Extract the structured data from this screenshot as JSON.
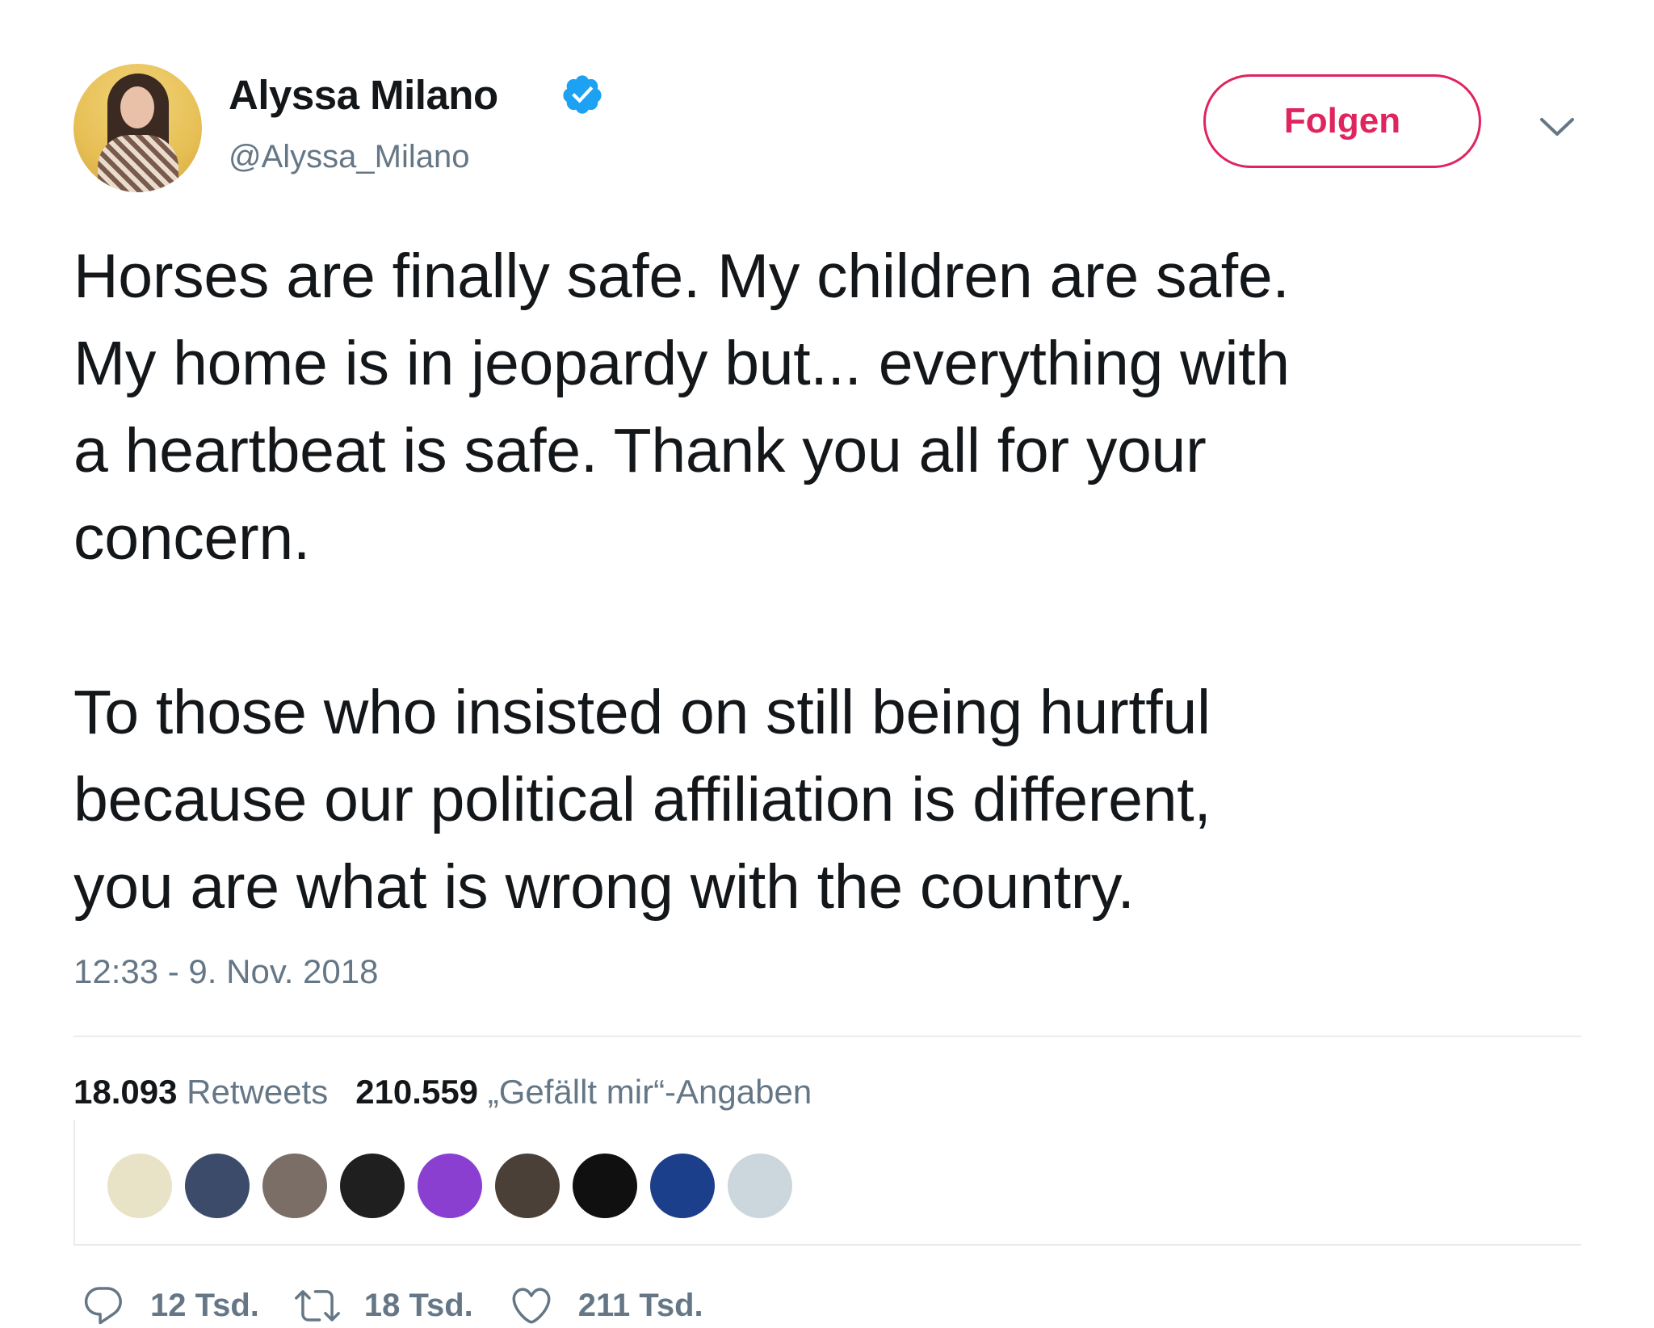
{
  "author": {
    "display_name": "Alyssa Milano",
    "handle": "@Alyssa_Milano",
    "verified_icon": "verified-badge-icon"
  },
  "follow_button": {
    "label": "Folgen"
  },
  "tweet": {
    "text": "Horses are finally safe. My children are safe.\nMy home is in jeopardy but... everything with\na heartbeat is safe. Thank you all for your\nconcern.\n\nTo those who insisted on still being hurtful\nbecause our political affiliation is different,\nyou are what is wrong with the country.",
    "timestamp": "12:33 - 9. Nov. 2018"
  },
  "stats": {
    "retweets_count": "18.093",
    "retweets_label": "Retweets",
    "likes_count": "210.559",
    "likes_label": "„Gefällt mir“-Angaben"
  },
  "facepile": {
    "avatars": [
      {
        "color": "#e8e2c6"
      },
      {
        "color": "#3d4b6b"
      },
      {
        "color": "#7a6e66"
      },
      {
        "color": "#1f1f1f"
      },
      {
        "color": "#8a3fd1"
      },
      {
        "color": "#4a4038"
      },
      {
        "color": "#101010"
      },
      {
        "color": "#1c3f8c"
      },
      {
        "color": "#ccd6dd"
      }
    ]
  },
  "actions": {
    "reply_count": "12 Tsd.",
    "retweet_count": "18 Tsd.",
    "like_count": "211 Tsd."
  },
  "colors": {
    "accent": "#e0245e",
    "verified": "#1da1f2",
    "secondary_text": "#657786",
    "divider": "#e6ecf0"
  }
}
